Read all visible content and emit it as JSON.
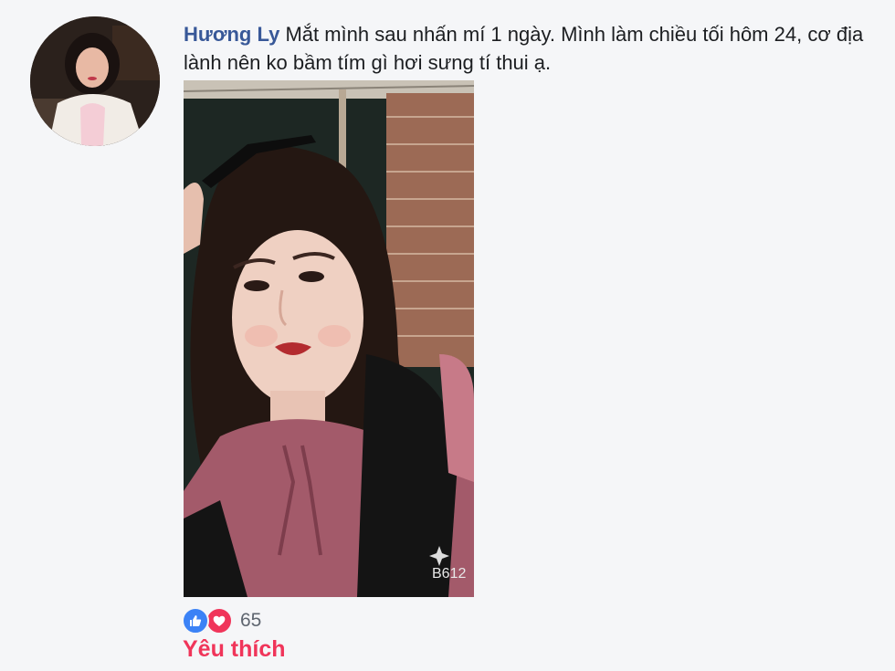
{
  "comment": {
    "author": "Hương Ly",
    "text": "Mắt mình sau nhấn mí 1 ngày. Mình làm chiều tối hôm 24, cơ địa lành nên ko bầm tím gì hơi sưng tí thui ạ."
  },
  "photo": {
    "watermark": "B612"
  },
  "reactions": {
    "count": "65",
    "types": [
      "like-icon",
      "heart-icon"
    ],
    "action_label": "Yêu thích"
  },
  "colors": {
    "author": "#385898",
    "like": "#3b82f6",
    "love": "#f0355a",
    "background": "#f5f6f8"
  }
}
